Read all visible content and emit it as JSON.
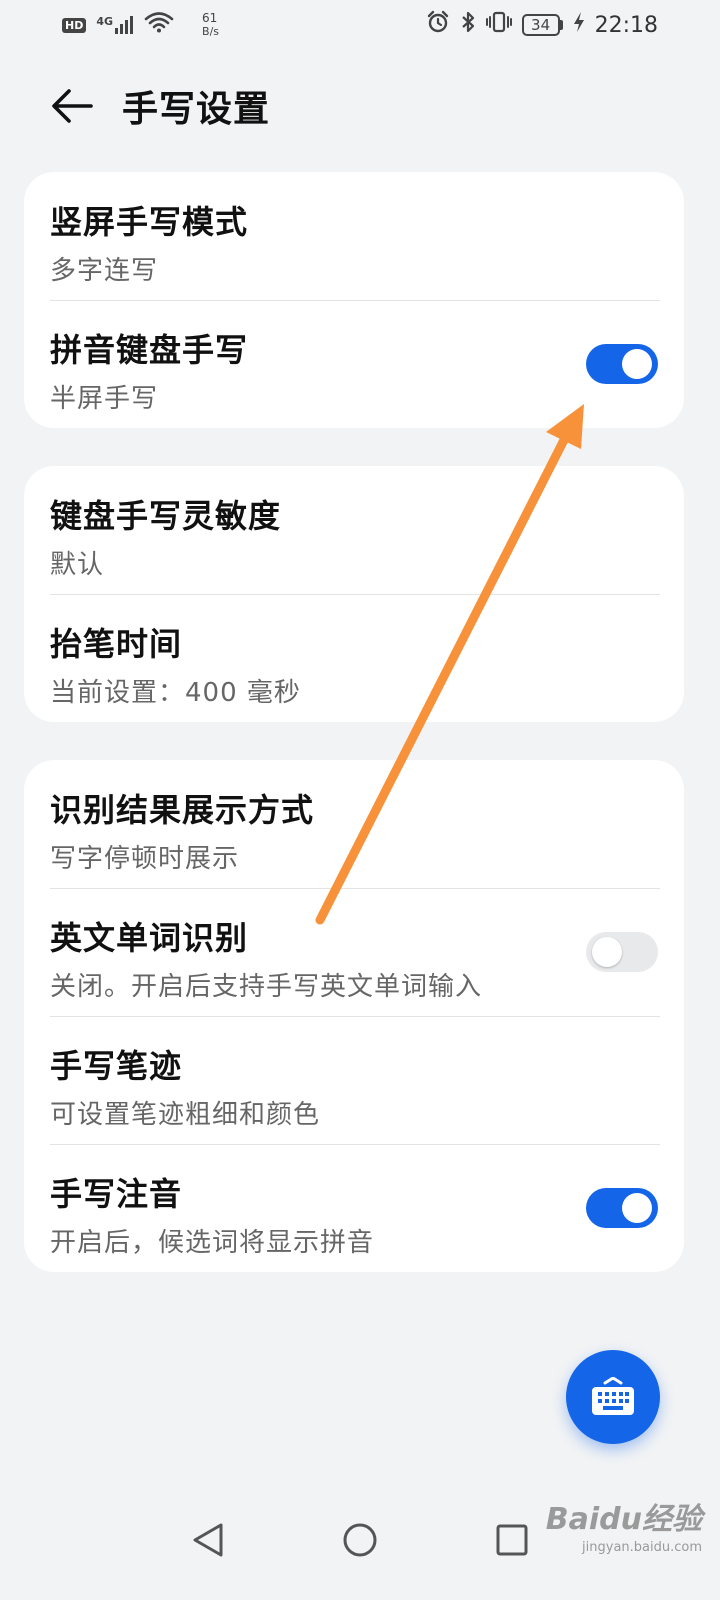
{
  "status_bar": {
    "hd": "HD",
    "network": "4G",
    "speed_value": "61",
    "speed_unit": "B/s",
    "battery": "34",
    "time": "22:18",
    "icons": [
      "signal-icon",
      "wifi-icon",
      "alarm-icon",
      "bluetooth-icon",
      "vibrate-icon",
      "battery-icon",
      "charging-icon"
    ]
  },
  "header": {
    "title": "手写设置",
    "back_icon": "back-arrow-icon"
  },
  "cards": [
    {
      "rows": [
        {
          "title": "竖屏手写模式",
          "subtitle": "多字连写"
        },
        {
          "title": "拼音键盘手写",
          "subtitle": "半屏手写",
          "toggle": true
        }
      ]
    },
    {
      "rows": [
        {
          "title": "键盘手写灵敏度",
          "subtitle": "默认"
        },
        {
          "title": "抬笔时间",
          "subtitle": "当前设置：400 毫秒"
        }
      ]
    },
    {
      "rows": [
        {
          "title": "识别结果展示方式",
          "subtitle": "写字停顿时展示"
        },
        {
          "title": "英文单词识别",
          "subtitle": "关闭。开启后支持手写英文单词输入",
          "toggle": false
        },
        {
          "title": "手写笔迹",
          "subtitle": "可设置笔迹粗细和颜色"
        },
        {
          "title": "手写注音",
          "subtitle": "开启后，候选词将显示拼音",
          "toggle": true
        }
      ]
    }
  ],
  "fab": {
    "icon": "keyboard-icon"
  },
  "nav_bar": {
    "icons": [
      "nav-back-icon",
      "nav-home-icon",
      "nav-recents-icon"
    ]
  },
  "watermark": {
    "logo": "Baidu经验",
    "site": "jingyan.baidu.com"
  },
  "colors": {
    "accent": "#1565e8",
    "background": "#f1f3f5",
    "card": "#ffffff",
    "annotation_arrow": "#f7923a",
    "toggle_off": "#e8e9eb"
  }
}
